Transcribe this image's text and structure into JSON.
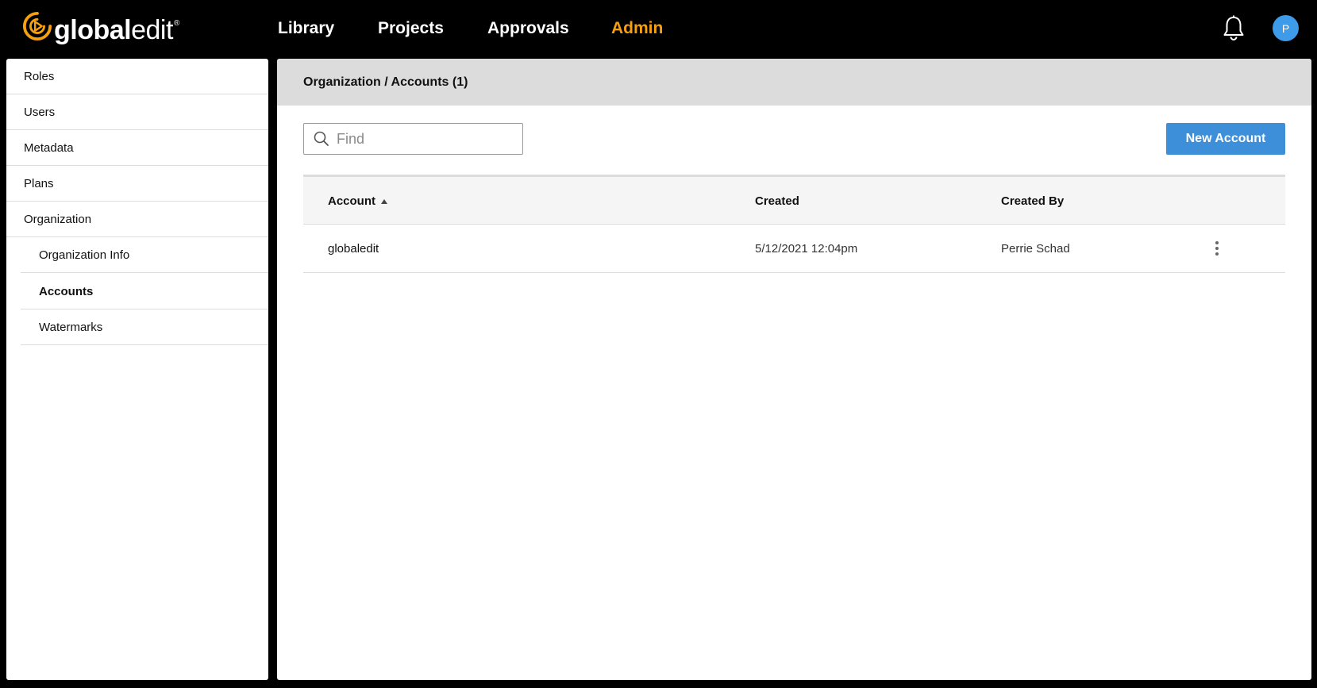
{
  "brand": {
    "wordmark_bold": "global",
    "wordmark_light": "edit",
    "registered": "®",
    "accent_color": "#f5a00f"
  },
  "nav": {
    "items": [
      {
        "label": "Library",
        "active": false
      },
      {
        "label": "Projects",
        "active": false
      },
      {
        "label": "Approvals",
        "active": false
      },
      {
        "label": "Admin",
        "active": true
      }
    ]
  },
  "header": {
    "bell_icon": "bell-icon",
    "avatar_initial": "P",
    "avatar_color": "#3d9be9"
  },
  "sidebar": {
    "items": [
      {
        "label": "Roles",
        "level": 0,
        "selected": false
      },
      {
        "label": "Users",
        "level": 0,
        "selected": false
      },
      {
        "label": "Metadata",
        "level": 0,
        "selected": false
      },
      {
        "label": "Plans",
        "level": 0,
        "selected": false
      },
      {
        "label": "Organization",
        "level": 0,
        "selected": false
      },
      {
        "label": "Organization Info",
        "level": 1,
        "selected": false
      },
      {
        "label": "Accounts",
        "level": 1,
        "selected": true
      },
      {
        "label": "Watermarks",
        "level": 1,
        "selected": false
      }
    ]
  },
  "main": {
    "breadcrumb": "Organization / Accounts (1)",
    "search": {
      "placeholder": "Find",
      "value": "",
      "icon": "search-icon"
    },
    "new_button_label": "New Account",
    "button_color": "#3d8fd9",
    "table": {
      "columns": [
        {
          "label": "Account",
          "sorted": "ascending"
        },
        {
          "label": "Created",
          "sorted": null
        },
        {
          "label": "Created By",
          "sorted": null
        }
      ],
      "rows": [
        {
          "account": "globaledit",
          "created": "5/12/2021 12:04pm",
          "created_by": "Perrie Schad"
        }
      ]
    }
  }
}
